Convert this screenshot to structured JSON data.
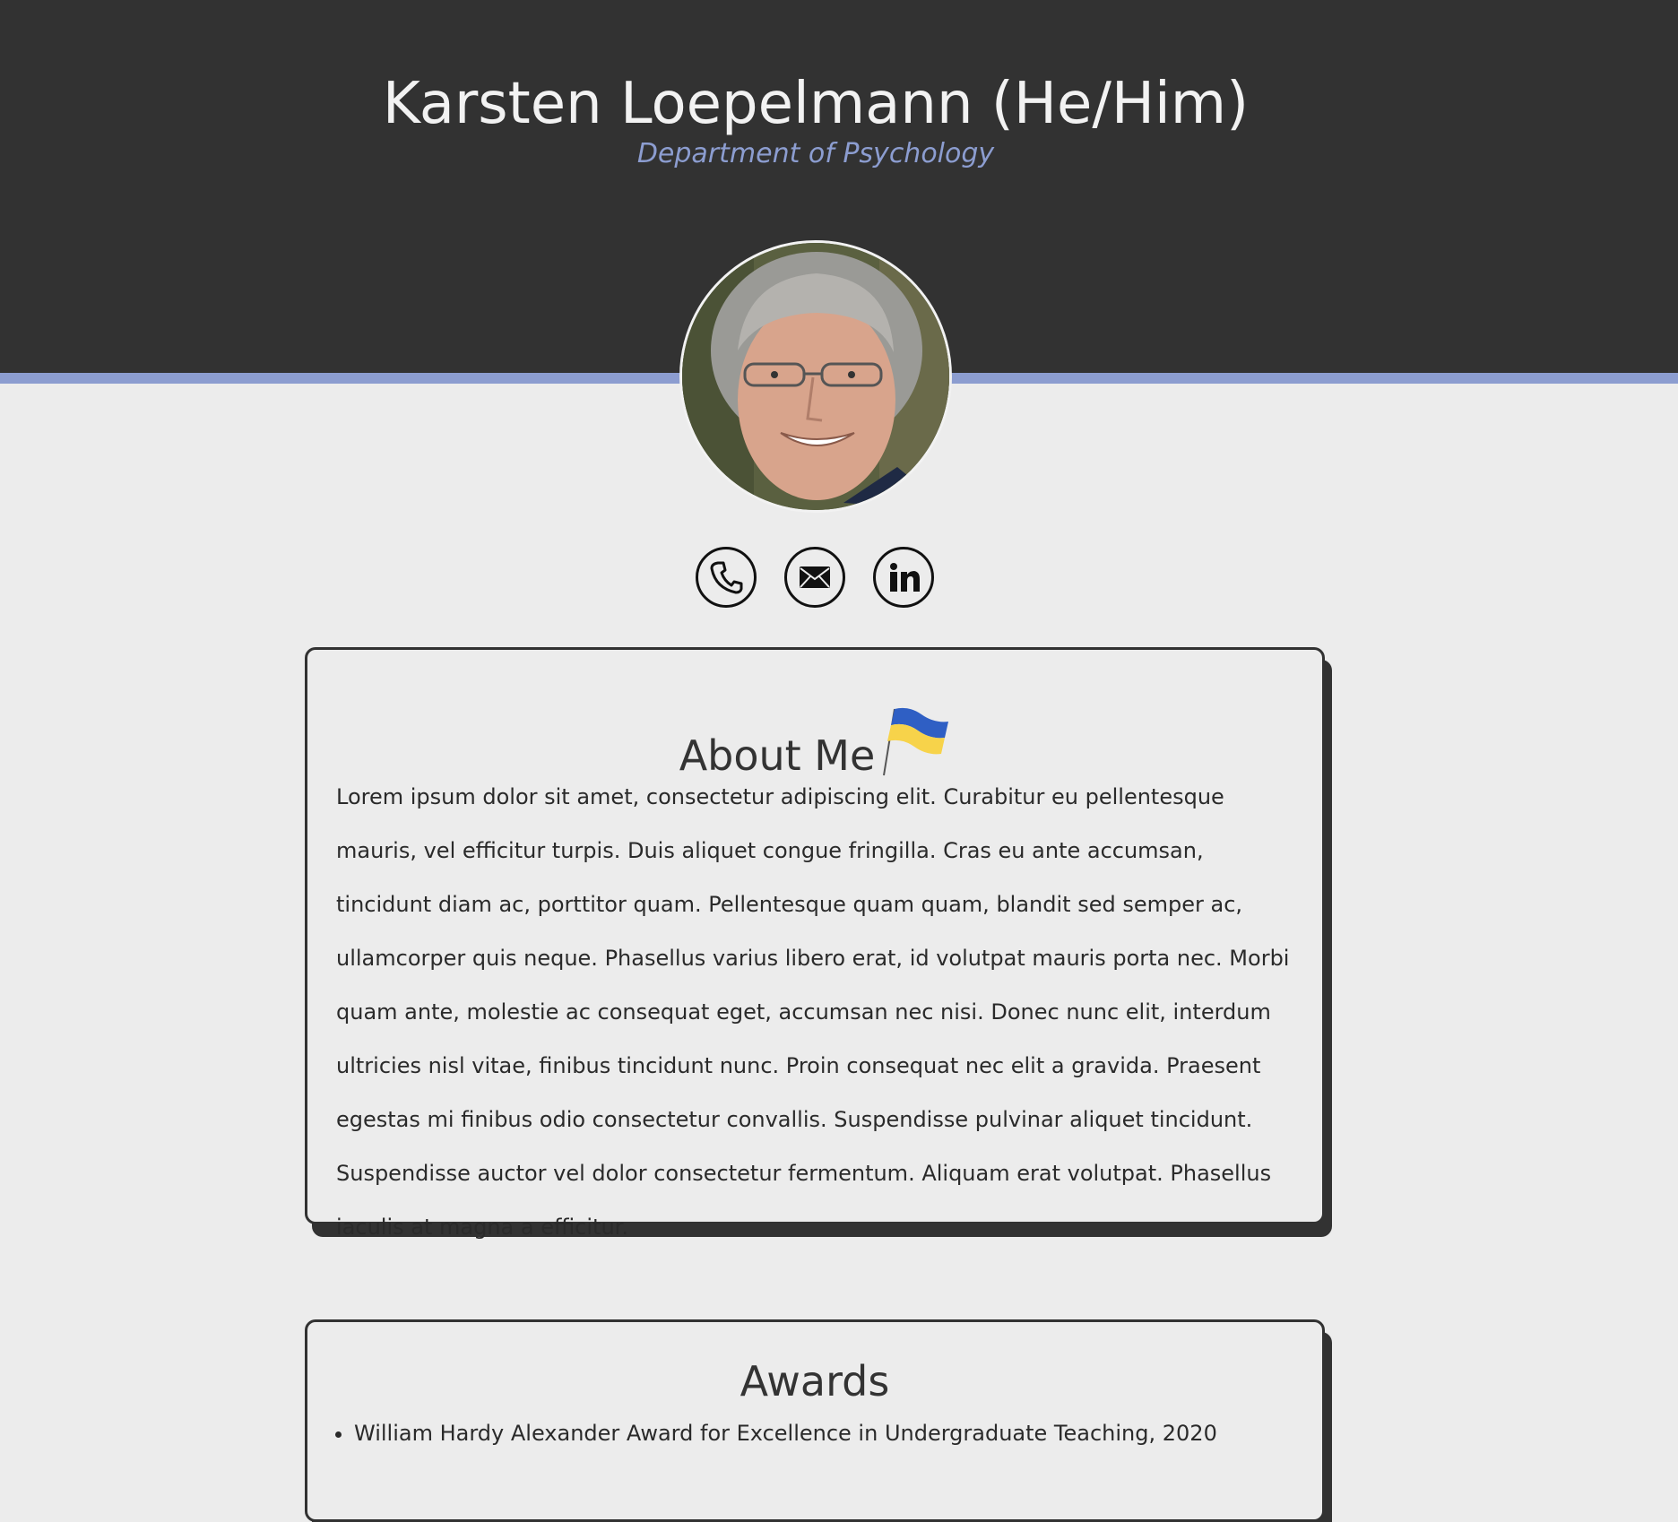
{
  "header": {
    "name": "Karsten Loepelmann (He/Him)",
    "department": "Department of Psychology",
    "colors": {
      "background": "#323232",
      "accent": "#8c9dd0"
    }
  },
  "contacts": [
    {
      "icon": "phone-icon",
      "label": "Phone"
    },
    {
      "icon": "envelope-icon",
      "label": "Email"
    },
    {
      "icon": "linkedin-icon",
      "label": "LinkedIn"
    }
  ],
  "about": {
    "title": "About Me",
    "flag_icon": "ukraine-flag-icon",
    "text": "Lorem ipsum dolor sit amet, consectetur adipiscing elit. Curabitur eu pellentesque mauris, vel efficitur turpis. Duis aliquet congue fringilla. Cras eu ante accumsan, tincidunt diam ac, porttitor quam. Pellentesque quam quam, blandit sed semper ac, ullamcorper quis neque. Phasellus varius libero erat, id volutpat mauris porta nec. Morbi quam ante, molestie ac consequat eget, accumsan nec nisi. Donec nunc elit, interdum ultricies nisl vitae, finibus tincidunt nunc. Proin consequat nec elit a gravida. Praesent egestas mi finibus odio consectetur convallis. Suspendisse pulvinar aliquet tincidunt. Suspendisse auctor vel dolor consectetur fermentum. Aliquam erat volutpat. Phasellus iaculis at magna a efficitur."
  },
  "awards": {
    "title": "Awards",
    "items": [
      "William Hardy Alexander Award for Excellence in Undergraduate Teaching, 2020"
    ]
  }
}
